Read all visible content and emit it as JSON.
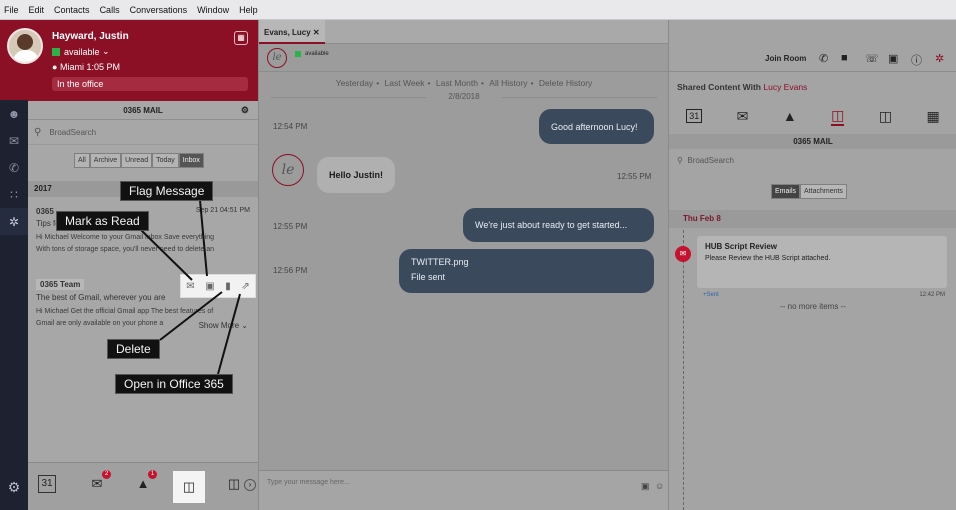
{
  "menu": [
    "File",
    "Edit",
    "Contacts",
    "Calls",
    "Conversations",
    "Window",
    "Help"
  ],
  "profile": {
    "name": "Hayward, Justin",
    "status": "available",
    "location": "Miami  1:05 PM",
    "note": "In the office"
  },
  "mail_panel": {
    "title": "0365 MAIL",
    "search_placeholder": "BroadSearch",
    "filters": [
      "All",
      "Archive",
      "Unread",
      "Today",
      "Inbox"
    ],
    "year": "2017",
    "messages": [
      {
        "from": "0365",
        "subject": "Tips fo",
        "date": "Sep 21 04:51 PM",
        "preview1": "Hi Michael Welcome to your Gmail inbox Save everything",
        "preview2": "With tons of storage space, you'll never need to delete an"
      },
      {
        "from": "0365 Team",
        "subject": "The best of Gmail, wherever you are",
        "preview1": "Hi Michael Get the official Gmail app The best features of",
        "preview2": "Gmail are only available on your phone a"
      }
    ],
    "show_more": "Show More",
    "bottom_badges": {
      "mail": "2",
      "drive": "1"
    }
  },
  "callouts": {
    "flag": "Flag Message",
    "mark_read": "Mark as Read",
    "delete": "Delete",
    "open_office": "Open in Office 365"
  },
  "chat": {
    "tab": "Evans, Lucy",
    "avatar_initials": "le",
    "contact_status": "available",
    "join_room": "Join Room",
    "history_links": [
      "Yesterday",
      "Last Week",
      "Last Month",
      "All History",
      "Delete History"
    ],
    "date": "2/8/2018",
    "messages": [
      {
        "time": "12:54 PM",
        "text": "Good afternoon Lucy!"
      },
      {
        "time": "12:55 PM",
        "text": "Hello Justin!"
      },
      {
        "time": "12:55 PM",
        "text": "We're just about ready to get started..."
      },
      {
        "time": "12:56 PM",
        "title": "TWITTER.png",
        "text": "File sent"
      }
    ],
    "compose_placeholder": "Type your message here..."
  },
  "shared": {
    "label": "Shared Content With",
    "contact": "Lucy Evans",
    "calendar_day": "31",
    "sub_title": "0365 MAIL",
    "search_placeholder": "BroadSearch",
    "tabs": [
      "Emails",
      "Attachments"
    ],
    "date": "Thu Feb 8",
    "item": {
      "title": "HUB Script Review",
      "body": "Please Review the HUB Script attached.",
      "state": "+Sent",
      "time": "12:42 PM"
    },
    "no_more": "-- no more items --"
  }
}
